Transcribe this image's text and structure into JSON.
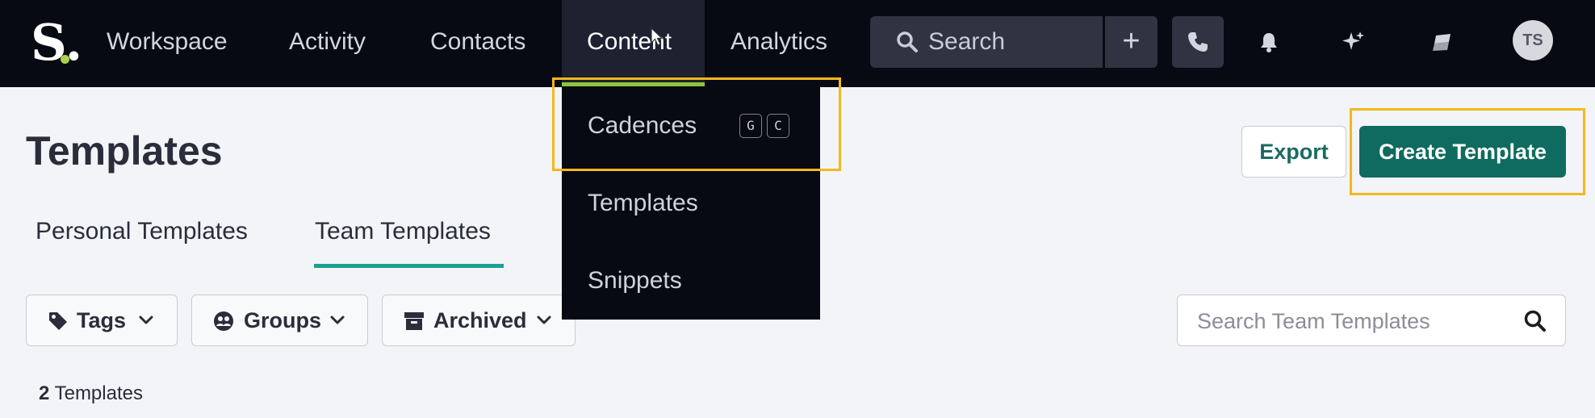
{
  "nav": {
    "logo_letter": "S.",
    "items": [
      {
        "label": "Workspace"
      },
      {
        "label": "Activity"
      },
      {
        "label": "Contacts"
      },
      {
        "label": "Content"
      },
      {
        "label": "Analytics"
      }
    ],
    "active_item": "Content",
    "search_label": "Search",
    "plus_label": "+",
    "avatar_initials": "TS",
    "icons": [
      "search-icon",
      "plus-icon",
      "phone-icon",
      "bell-icon",
      "sparkle-icon",
      "app-icon"
    ],
    "accent_color": "#8cc63f"
  },
  "content_menu": {
    "items": [
      {
        "label": "Cadences",
        "shortcut": [
          "G",
          "C"
        ]
      },
      {
        "label": "Templates"
      },
      {
        "label": "Snippets"
      }
    ]
  },
  "page": {
    "title": "Templates",
    "export_label": "Export",
    "create_label": "Create Template",
    "primary_color": "#0f6b5f",
    "tabs": [
      {
        "label": "Personal Templates"
      },
      {
        "label": "Team Templates",
        "active": true
      }
    ],
    "filters": [
      {
        "label": "Tags",
        "icon": "tag-icon"
      },
      {
        "label": "Groups",
        "icon": "group-icon"
      },
      {
        "label": "Archived",
        "icon": "archive-icon"
      }
    ],
    "search_placeholder": "Search Team Templates",
    "count_number": "2",
    "count_label": "Templates"
  },
  "highlight_color": "#f3b81f"
}
